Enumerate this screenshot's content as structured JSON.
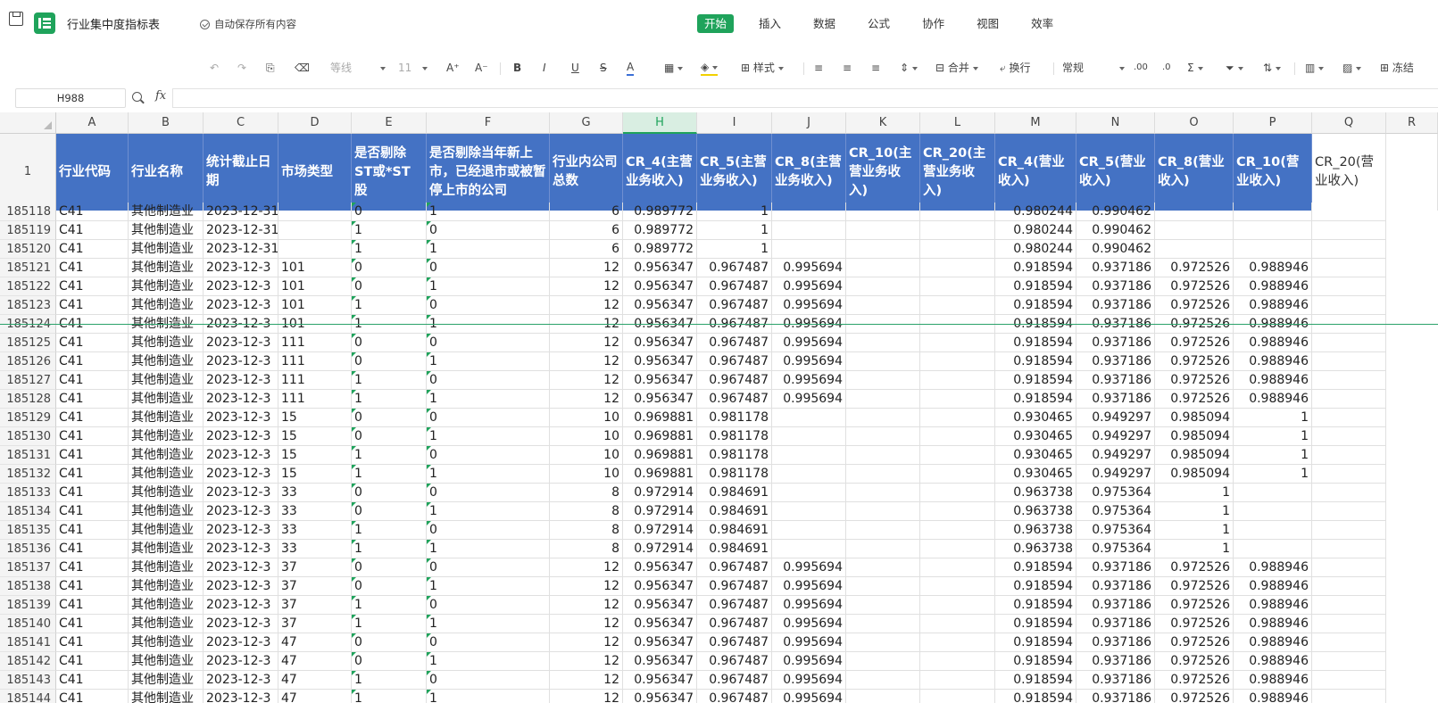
{
  "title_bar": {
    "doc_title": "行业集中度指标表",
    "autosave": "自动保存所有内容"
  },
  "menu_tabs": [
    "开始",
    "插入",
    "数据",
    "公式",
    "协作",
    "视图",
    "效率"
  ],
  "toolbar": {
    "font": "等线",
    "size": "11",
    "style": "样式",
    "merge": "合并",
    "wrap": "换行",
    "format": "常规",
    "freeze": "冻结"
  },
  "formula_bar": {
    "cell_ref": "H988",
    "fx": "fx",
    "value": ""
  },
  "columns": [
    "A",
    "B",
    "C",
    "D",
    "E",
    "F",
    "G",
    "H",
    "I",
    "J",
    "K",
    "L",
    "M",
    "N",
    "O",
    "P",
    "Q",
    "R"
  ],
  "selected_column": "H",
  "header_row": {
    "row_number": "1",
    "cells": [
      "行业代码",
      "行业名称",
      "统计截止日期",
      "市场类型",
      "是否剔除ST或*ST股",
      "是否剔除当年新上市，已经退市或被暂停上市的公司",
      "行业内公司总数",
      "CR_4(主营业务收入)",
      "CR_5(主营业务收入)",
      "CR_8(主营业务收入)",
      "CR_10(主营业务收入)",
      "CR_20(主营业务收入)",
      "CR_4(营业收入)",
      "CR_5(营业收入)",
      "CR_8(营业收入)",
      "CR_10(营业收入)",
      "CR_20(营业收入)",
      ""
    ]
  },
  "rows": [
    [
      "185118",
      "C41",
      "其他制造业",
      "2023-12-31",
      "",
      "0",
      "1",
      "6",
      "0.989772",
      "1",
      "",
      "",
      "",
      "0.980244",
      "0.990462",
      "",
      "",
      ""
    ],
    [
      "185119",
      "C41",
      "其他制造业",
      "2023-12-31",
      "",
      "1",
      "0",
      "6",
      "0.989772",
      "1",
      "",
      "",
      "",
      "0.980244",
      "0.990462",
      "",
      "",
      ""
    ],
    [
      "185120",
      "C41",
      "其他制造业",
      "2023-12-31",
      "",
      "1",
      "1",
      "6",
      "0.989772",
      "1",
      "",
      "",
      "",
      "0.980244",
      "0.990462",
      "",
      "",
      ""
    ],
    [
      "185121",
      "C41",
      "其他制造业",
      "2023-12-3",
      "101",
      "0",
      "0",
      "12",
      "0.956347",
      "0.967487",
      "0.995694",
      "",
      "",
      "0.918594",
      "0.937186",
      "0.972526",
      "0.988946",
      ""
    ],
    [
      "185122",
      "C41",
      "其他制造业",
      "2023-12-3",
      "101",
      "0",
      "1",
      "12",
      "0.956347",
      "0.967487",
      "0.995694",
      "",
      "",
      "0.918594",
      "0.937186",
      "0.972526",
      "0.988946",
      ""
    ],
    [
      "185123",
      "C41",
      "其他制造业",
      "2023-12-3",
      "101",
      "1",
      "0",
      "12",
      "0.956347",
      "0.967487",
      "0.995694",
      "",
      "",
      "0.918594",
      "0.937186",
      "0.972526",
      "0.988946",
      ""
    ],
    [
      "185124",
      "C41",
      "其他制造业",
      "2023-12-3",
      "101",
      "1",
      "1",
      "12",
      "0.956347",
      "0.967487",
      "0.995694",
      "",
      "",
      "0.918594",
      "0.937186",
      "0.972526",
      "0.988946",
      ""
    ],
    [
      "185125",
      "C41",
      "其他制造业",
      "2023-12-3",
      "111",
      "0",
      "0",
      "12",
      "0.956347",
      "0.967487",
      "0.995694",
      "",
      "",
      "0.918594",
      "0.937186",
      "0.972526",
      "0.988946",
      ""
    ],
    [
      "185126",
      "C41",
      "其他制造业",
      "2023-12-3",
      "111",
      "0",
      "1",
      "12",
      "0.956347",
      "0.967487",
      "0.995694",
      "",
      "",
      "0.918594",
      "0.937186",
      "0.972526",
      "0.988946",
      ""
    ],
    [
      "185127",
      "C41",
      "其他制造业",
      "2023-12-3",
      "111",
      "1",
      "0",
      "12",
      "0.956347",
      "0.967487",
      "0.995694",
      "",
      "",
      "0.918594",
      "0.937186",
      "0.972526",
      "0.988946",
      ""
    ],
    [
      "185128",
      "C41",
      "其他制造业",
      "2023-12-3",
      "111",
      "1",
      "1",
      "12",
      "0.956347",
      "0.967487",
      "0.995694",
      "",
      "",
      "0.918594",
      "0.937186",
      "0.972526",
      "0.988946",
      ""
    ],
    [
      "185129",
      "C41",
      "其他制造业",
      "2023-12-3",
      "15",
      "0",
      "0",
      "10",
      "0.969881",
      "0.981178",
      "",
      "",
      "",
      "0.930465",
      "0.949297",
      "0.985094",
      "1",
      ""
    ],
    [
      "185130",
      "C41",
      "其他制造业",
      "2023-12-3",
      "15",
      "0",
      "1",
      "10",
      "0.969881",
      "0.981178",
      "",
      "",
      "",
      "0.930465",
      "0.949297",
      "0.985094",
      "1",
      ""
    ],
    [
      "185131",
      "C41",
      "其他制造业",
      "2023-12-3",
      "15",
      "1",
      "0",
      "10",
      "0.969881",
      "0.981178",
      "",
      "",
      "",
      "0.930465",
      "0.949297",
      "0.985094",
      "1",
      ""
    ],
    [
      "185132",
      "C41",
      "其他制造业",
      "2023-12-3",
      "15",
      "1",
      "1",
      "10",
      "0.969881",
      "0.981178",
      "",
      "",
      "",
      "0.930465",
      "0.949297",
      "0.985094",
      "1",
      ""
    ],
    [
      "185133",
      "C41",
      "其他制造业",
      "2023-12-3",
      "33",
      "0",
      "0",
      "8",
      "0.972914",
      "0.984691",
      "",
      "",
      "",
      "0.963738",
      "0.975364",
      "1",
      "",
      ""
    ],
    [
      "185134",
      "C41",
      "其他制造业",
      "2023-12-3",
      "33",
      "0",
      "1",
      "8",
      "0.972914",
      "0.984691",
      "",
      "",
      "",
      "0.963738",
      "0.975364",
      "1",
      "",
      ""
    ],
    [
      "185135",
      "C41",
      "其他制造业",
      "2023-12-3",
      "33",
      "1",
      "0",
      "8",
      "0.972914",
      "0.984691",
      "",
      "",
      "",
      "0.963738",
      "0.975364",
      "1",
      "",
      ""
    ],
    [
      "185136",
      "C41",
      "其他制造业",
      "2023-12-3",
      "33",
      "1",
      "1",
      "8",
      "0.972914",
      "0.984691",
      "",
      "",
      "",
      "0.963738",
      "0.975364",
      "1",
      "",
      ""
    ],
    [
      "185137",
      "C41",
      "其他制造业",
      "2023-12-3",
      "37",
      "0",
      "0",
      "12",
      "0.956347",
      "0.967487",
      "0.995694",
      "",
      "",
      "0.918594",
      "0.937186",
      "0.972526",
      "0.988946",
      ""
    ],
    [
      "185138",
      "C41",
      "其他制造业",
      "2023-12-3",
      "37",
      "0",
      "1",
      "12",
      "0.956347",
      "0.967487",
      "0.995694",
      "",
      "",
      "0.918594",
      "0.937186",
      "0.972526",
      "0.988946",
      ""
    ],
    [
      "185139",
      "C41",
      "其他制造业",
      "2023-12-3",
      "37",
      "1",
      "0",
      "12",
      "0.956347",
      "0.967487",
      "0.995694",
      "",
      "",
      "0.918594",
      "0.937186",
      "0.972526",
      "0.988946",
      ""
    ],
    [
      "185140",
      "C41",
      "其他制造业",
      "2023-12-3",
      "37",
      "1",
      "1",
      "12",
      "0.956347",
      "0.967487",
      "0.995694",
      "",
      "",
      "0.918594",
      "0.937186",
      "0.972526",
      "0.988946",
      ""
    ],
    [
      "185141",
      "C41",
      "其他制造业",
      "2023-12-3",
      "47",
      "0",
      "0",
      "12",
      "0.956347",
      "0.967487",
      "0.995694",
      "",
      "",
      "0.918594",
      "0.937186",
      "0.972526",
      "0.988946",
      ""
    ],
    [
      "185142",
      "C41",
      "其他制造业",
      "2023-12-3",
      "47",
      "0",
      "1",
      "12",
      "0.956347",
      "0.967487",
      "0.995694",
      "",
      "",
      "0.918594",
      "0.937186",
      "0.972526",
      "0.988946",
      ""
    ],
    [
      "185143",
      "C41",
      "其他制造业",
      "2023-12-3",
      "47",
      "1",
      "0",
      "12",
      "0.956347",
      "0.967487",
      "0.995694",
      "",
      "",
      "0.918594",
      "0.937186",
      "0.972526",
      "0.988946",
      ""
    ],
    [
      "185144",
      "C41",
      "其他制造业",
      "2023-12-3",
      "47",
      "1",
      "1",
      "12",
      "0.956347",
      "0.967487",
      "0.995694",
      "",
      "",
      "0.918594",
      "0.937186",
      "0.972526",
      "0.988946",
      ""
    ]
  ],
  "colors": {
    "accent": "#1fa35b",
    "header_fill": "#4472c4"
  }
}
